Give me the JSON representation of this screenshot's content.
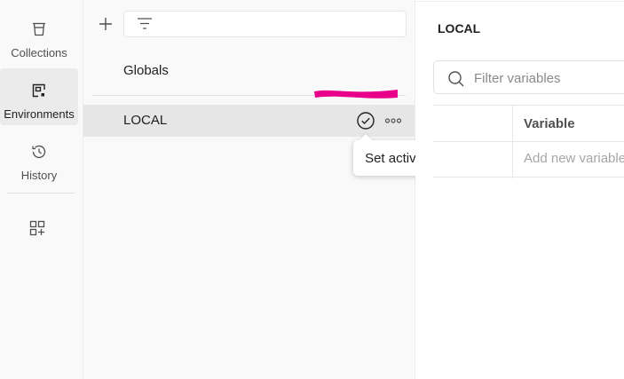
{
  "sidebar": {
    "items": [
      {
        "label": "Collections",
        "icon": "trash-can-icon",
        "active": false
      },
      {
        "label": "Environments",
        "icon": "environment-icon",
        "active": true
      },
      {
        "label": "History",
        "icon": "history-icon",
        "active": false
      }
    ],
    "more_icon": "configure-workbench-icon"
  },
  "env_list": {
    "add_icon": "plus-icon",
    "filter_icon": "filter-icon",
    "items": [
      {
        "name": "Globals"
      },
      {
        "name": "LOCAL",
        "selected": true
      }
    ],
    "row_actions": {
      "set_active_icon": "check-circle-icon",
      "more_icon": "ellipsis-icon"
    },
    "tooltip": "Set active"
  },
  "detail": {
    "title": "LOCAL",
    "search": {
      "placeholder": "Filter variables",
      "value": ""
    },
    "table": {
      "header": "Variable",
      "add_placeholder": "Add new variable"
    }
  },
  "colors": {
    "redaction_mark": "#e8008a",
    "selected_row": "#e6e6e6",
    "active_rail": "#ebebeb"
  }
}
